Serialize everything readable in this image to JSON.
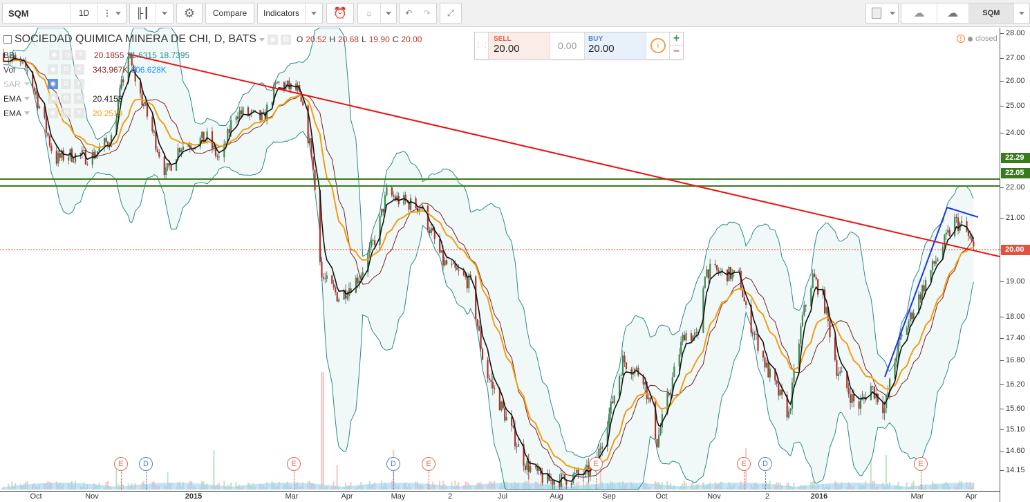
{
  "toolbar": {
    "symbol": "SQM",
    "interval": "1D",
    "compare_label": "Compare",
    "indicators_label": "Indicators",
    "right_symbol": "SQM"
  },
  "legend": {
    "title": "SOCIEDAD QUIMICA MINERA DE CHI, D, BATS",
    "ohlc": {
      "o_label": "O",
      "o": "20.52",
      "h_label": "H",
      "h": "20.68",
      "l_label": "L",
      "l": "19.90",
      "c_label": "C",
      "c": "20.00"
    },
    "bb": {
      "label": "BB",
      "v1": "20.1855",
      "v2": "21.6315",
      "v3": "18.7395"
    },
    "vol": {
      "label": "Vol",
      "v1": "343.967K",
      "v2": "606.628K"
    },
    "sar": {
      "label": "SAR"
    },
    "ema1": {
      "label": "EMA",
      "value": "20.4153"
    },
    "ema2": {
      "label": "EMA",
      "value": "20.2519"
    }
  },
  "trade": {
    "sell_label": "SELL",
    "sell": "20.00",
    "spread": "0.00",
    "buy_label": "BUY",
    "buy": "20.00",
    "plus": "+",
    "minus": "−"
  },
  "status": "closed",
  "axis": {
    "ticks": [
      "28.00",
      "27.00",
      "26.00",
      "25.00",
      "24.00",
      "22.00",
      "21.00",
      "20.00",
      "19.00",
      "18.00",
      "17.40",
      "16.80",
      "16.20",
      "15.60",
      "15.10",
      "14.60",
      "14.15"
    ],
    "badges": {
      "level1": "22.29",
      "level2": "22.05",
      "last": "20.00"
    }
  },
  "xaxis": [
    "Oct",
    "Nov",
    "2015",
    "Mar",
    "Apr",
    "May",
    "2",
    "Jul",
    "Aug",
    "Sep",
    "Oct",
    "Nov",
    "2",
    "2016",
    "Mar",
    "Apr"
  ],
  "events": [
    "E",
    "D",
    "E",
    "D",
    "E",
    "E",
    "E",
    "D",
    "E"
  ],
  "colors": {
    "up": "#3d8a50",
    "down": "#b5322a",
    "ema_fast": "#111111",
    "ema_slow": "#f39c12",
    "basis": "#7b1f1f",
    "bands": "#2a8a88",
    "trendline": "#ee1111",
    "support": "#3a7a1f",
    "channel": "#1a33ee"
  },
  "chart_data": {
    "type": "line",
    "title": "SOCIEDAD QUIMICA MINERA DE CHI, D, BATS",
    "ylim": [
      14.15,
      28.0
    ],
    "y_scale": "log",
    "grid": false,
    "approx_closes": [
      [
        "2014-09-12",
        27.2
      ],
      [
        "2014-09-26",
        26.5
      ],
      [
        "2014-10-12",
        23.0
      ],
      [
        "2014-10-20",
        23.2
      ],
      [
        "2014-11-02",
        23.1
      ],
      [
        "2014-11-14",
        23.8
      ],
      [
        "2014-11-24",
        27.1
      ],
      [
        "2014-11-30",
        25.6
      ],
      [
        "2014-12-16",
        22.5
      ],
      [
        "2014-12-24",
        23.5
      ],
      [
        "2015-01-09",
        23.8
      ],
      [
        "2015-01-17",
        22.9
      ],
      [
        "2015-01-25",
        24.8
      ],
      [
        "2015-02-11",
        24.5
      ],
      [
        "2015-02-19",
        25.9
      ],
      [
        "2015-03-03",
        25.6
      ],
      [
        "2015-03-11",
        23.3
      ],
      [
        "2015-03-17",
        19.15
      ],
      [
        "2015-03-27",
        18.55
      ],
      [
        "2015-04-08",
        19.15
      ],
      [
        "2015-04-18",
        20.45
      ],
      [
        "2015-04-24",
        21.8
      ],
      [
        "2015-05-02",
        21.55
      ],
      [
        "2015-05-14",
        21.35
      ],
      [
        "2015-05-27",
        19.6
      ],
      [
        "2015-06-12",
        18.95
      ],
      [
        "2015-06-20",
        16.6
      ],
      [
        "2015-07-02",
        15.45
      ],
      [
        "2015-07-14",
        14.3
      ],
      [
        "2015-07-26",
        13.9
      ],
      [
        "2015-08-07",
        13.95
      ],
      [
        "2015-08-23",
        14.15
      ],
      [
        "2015-09-01",
        15.45
      ],
      [
        "2015-09-09",
        16.8
      ],
      [
        "2015-09-21",
        16.4
      ],
      [
        "2015-09-29",
        14.8
      ],
      [
        "2015-10-07",
        16.15
      ],
      [
        "2015-10-15",
        17.55
      ],
      [
        "2015-10-23",
        17.4
      ],
      [
        "2015-10-27",
        19.35
      ],
      [
        "2015-11-08",
        19.25
      ],
      [
        "2015-11-16",
        19.15
      ],
      [
        "2015-11-20",
        18.15
      ],
      [
        "2015-12-02",
        16.6
      ],
      [
        "2015-12-15",
        15.45
      ],
      [
        "2015-12-23",
        17.95
      ],
      [
        "2015-12-29",
        19.15
      ],
      [
        "2016-01-04",
        18.55
      ],
      [
        "2016-01-12",
        16.6
      ],
      [
        "2016-01-24",
        15.6
      ],
      [
        "2016-02-01",
        16.15
      ],
      [
        "2016-02-09",
        15.6
      ],
      [
        "2016-02-17",
        17.2
      ],
      [
        "2016-02-29",
        18.55
      ],
      [
        "2016-03-13",
        20.0
      ],
      [
        "2016-03-21",
        20.9
      ],
      [
        "2016-03-27",
        20.65
      ],
      [
        "2016-04-01",
        20.0
      ]
    ],
    "horizontal_levels": [
      22.29,
      22.05,
      20.0
    ]
  }
}
